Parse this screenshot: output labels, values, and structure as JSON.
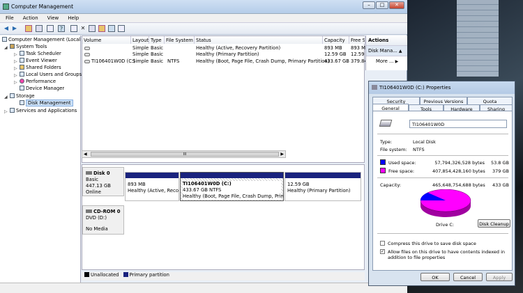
{
  "window": {
    "title": "Computer Management",
    "min": "–",
    "max": "□",
    "close": "✕"
  },
  "menu": [
    "File",
    "Action",
    "View",
    "Help"
  ],
  "tree": {
    "root": "Computer Management (Local",
    "system_tools": "System Tools",
    "task_scheduler": "Task Scheduler",
    "event_viewer": "Event Viewer",
    "shared_folders": "Shared Folders",
    "local_users": "Local Users and Groups",
    "performance": "Performance",
    "device_manager": "Device Manager",
    "storage": "Storage",
    "disk_management": "Disk Management",
    "services": "Services and Applications"
  },
  "volumes": {
    "headers": [
      "Volume",
      "Layout",
      "Type",
      "File System",
      "Status",
      "Capacity",
      "Free S"
    ],
    "rows": [
      [
        "",
        "Simple",
        "Basic",
        "",
        "Healthy (Active, Recovery Partition)",
        "893 MB",
        "893 M"
      ],
      [
        "",
        "Simple",
        "Basic",
        "",
        "Healthy (Primary Partition)",
        "12.59 GB",
        "12.59"
      ],
      [
        "TI106401W0D (C:)",
        "Simple",
        "Basic",
        "NTFS",
        "Healthy (Boot, Page File, Crash Dump, Primary Partition)",
        "433.67 GB",
        "379.84"
      ]
    ]
  },
  "scroll_mid": "III",
  "disks": {
    "disk0": {
      "name": "Disk 0",
      "type": "Basic",
      "size": "447.13 GB",
      "state": "Online"
    },
    "cdrom": {
      "name": "CD-ROM 0",
      "type": "DVD (D:)",
      "state": "No Media"
    },
    "parts": [
      {
        "line1": "893 MB",
        "line2": "Healthy (Active, Recov"
      },
      {
        "title": "TI106401W0D  (C:)",
        "line1": "433.67 GB NTFS",
        "line2": "Healthy (Boot, Page File, Crash Dump, Primar"
      },
      {
        "line1": "12.59 GB",
        "line2": "Healthy (Primary Partition)"
      }
    ]
  },
  "legend": {
    "unallocated": "Unallocated",
    "primary": "Primary partition",
    "unallocated_color": "#000000",
    "primary_color": "#1a237e"
  },
  "actions": {
    "header": "Actions",
    "item1": "Disk Mana...",
    "item2": "More ..."
  },
  "props": {
    "title": "TI106401W0D (C:) Properties",
    "tabs_row1": [
      "Security",
      "Previous Versions",
      "Quota"
    ],
    "tabs_row2": [
      "General",
      "Tools",
      "Hardware",
      "Sharing"
    ],
    "label_value": "TI106401W0D",
    "type_label": "Type:",
    "type_value": "Local Disk",
    "fs_label": "File system:",
    "fs_value": "NTFS",
    "used_label": "Used space:",
    "used_bytes": "57,794,326,528 bytes",
    "used_gb": "53.8 GB",
    "free_label": "Free space:",
    "free_bytes": "407,854,428,160 bytes",
    "free_gb": "379 GB",
    "cap_label": "Capacity:",
    "cap_bytes": "465,648,754,688 bytes",
    "cap_gb": "433 GB",
    "drive": "Drive C:",
    "cleanup": "Disk Cleanup",
    "compress": "Compress this drive to save disk space",
    "index": "Allow files on this drive to have contents indexed in addition to file properties",
    "ok": "OK",
    "cancel": "Cancel",
    "apply": "Apply",
    "used_color": "#0000ff",
    "free_color": "#ff00ff",
    "used_fraction": 0.124
  }
}
